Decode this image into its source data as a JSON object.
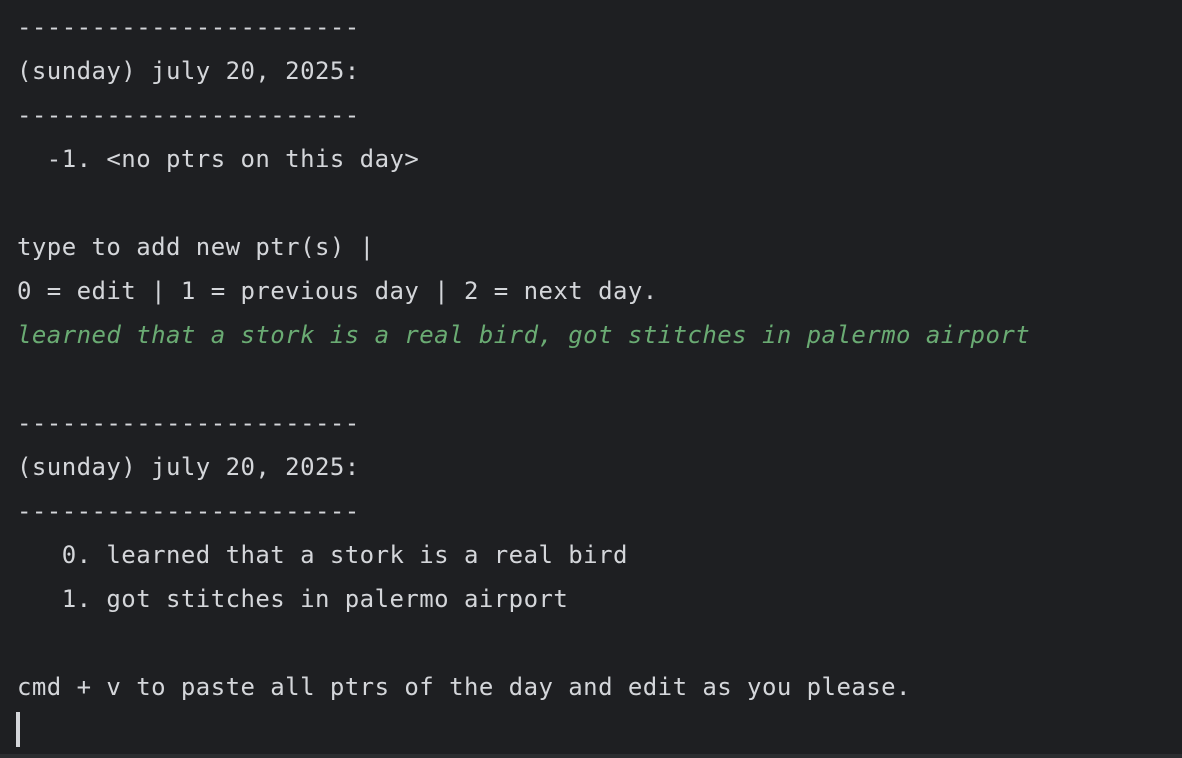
{
  "terminal": {
    "block1": {
      "separator_top": "-----------------------",
      "date_header": "(sunday) july 20, 2025:",
      "separator_bottom": "-----------------------",
      "entries": [
        "  -1. <no ptrs on this day>"
      ]
    },
    "prompt": {
      "line1": "type to add new ptr(s) |",
      "line2": "0 = edit | 1 = previous day | 2 = next day."
    },
    "user_input": "learned that a stork is a real bird, got stitches in palermo airport",
    "block2": {
      "separator_top": "-----------------------",
      "date_header": "(sunday) july 20, 2025:",
      "separator_bottom": "-----------------------",
      "entries": [
        "   0. learned that a stork is a real bird",
        "   1. got stitches in palermo airport"
      ]
    },
    "footer_hint": "cmd + v to paste all ptrs of the day and edit as you please."
  },
  "colors": {
    "background": "#1e1f22",
    "text": "#d4d6da",
    "input_text": "#6aab73"
  }
}
